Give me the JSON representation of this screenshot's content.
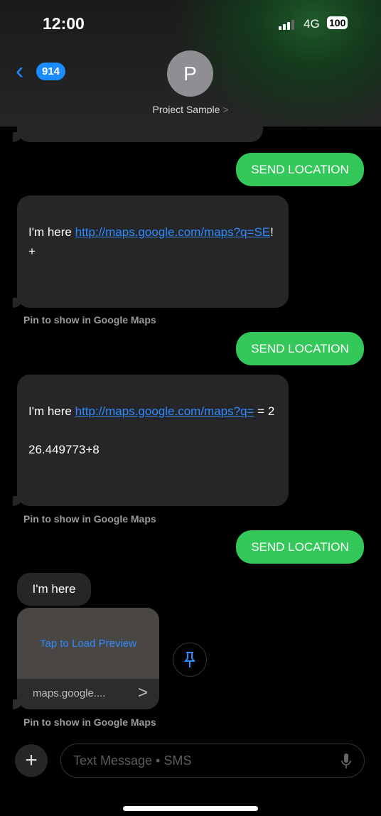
{
  "status_bar": {
    "time": "12:00",
    "network": "4G",
    "battery": "100"
  },
  "header": {
    "back_count": "914",
    "avatar_initial": "P",
    "contact_name": "Project Sample",
    "chevron": ">"
  },
  "messages": {
    "sent_1": "SEND LOCATION",
    "recv_1": {
      "prefix": "I'm here ",
      "link": "http://maps.google.com/maps?q=SE",
      "suffix": "!",
      "line2": "+"
    },
    "caption": "Pin to show in Google Maps",
    "sent_2": "SEND LOCATION",
    "recv_2": {
      "prefix": "I'm here ",
      "link": "http://maps.google.com/maps?q=",
      "suffix": " = 2",
      "line3": "26.449773+8"
    },
    "sent_3": "SEND LOCATION",
    "recv_3": "I'm here",
    "preview": {
      "load_label": "Tap to Load Preview",
      "domain": "maps.google....",
      "chevron": ">"
    }
  },
  "composer": {
    "placeholder": "Text Message • SMS",
    "plus": "+"
  },
  "colors": {
    "sent": "#34c759",
    "link": "#2f8bff",
    "received": "#262628"
  }
}
